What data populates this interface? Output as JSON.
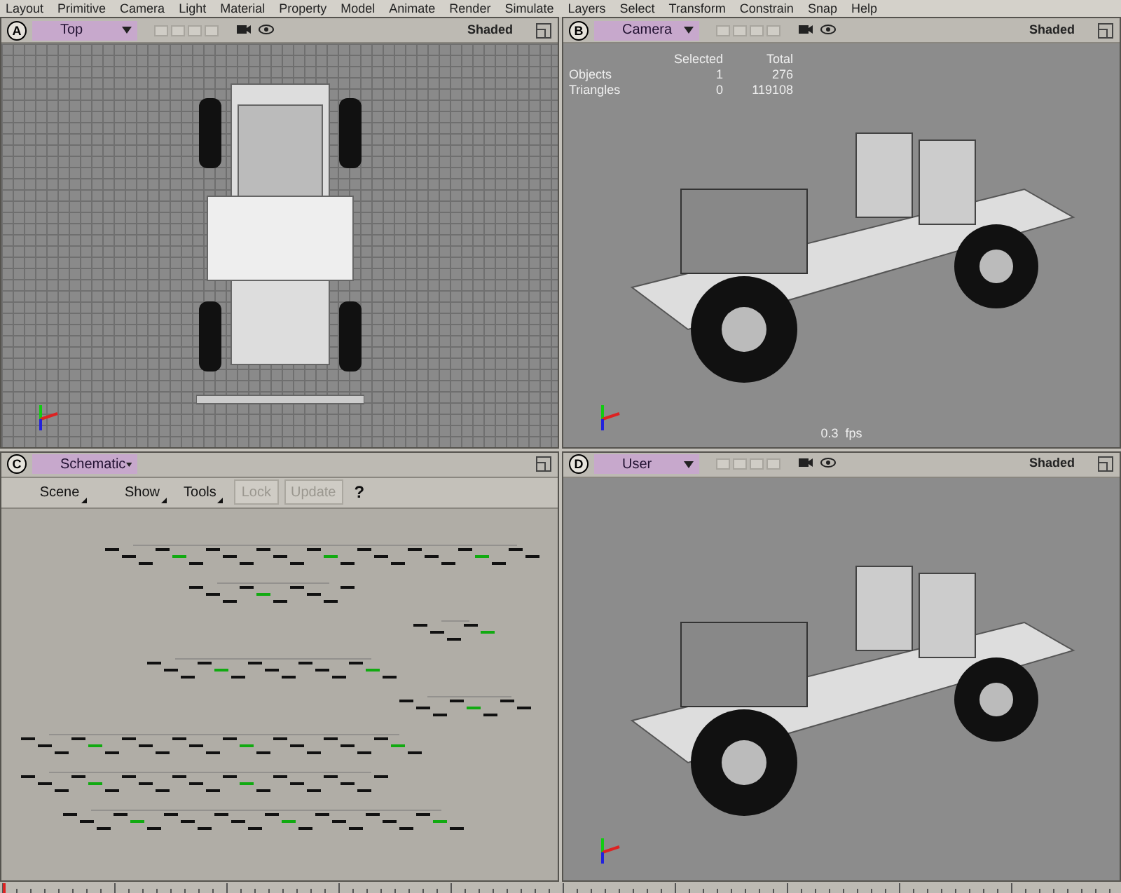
{
  "menu": [
    "Layout",
    "Primitive",
    "Camera",
    "Light",
    "Material",
    "Property",
    "Model",
    "Animate",
    "Render",
    "Simulate",
    "Layers",
    "Select",
    "Transform",
    "Constrain",
    "Snap",
    "Help"
  ],
  "viewports": [
    {
      "letter": "A",
      "title": "Top",
      "kind": "top",
      "mode": "Shaded"
    },
    {
      "letter": "B",
      "title": "Camera",
      "kind": "camera",
      "mode": "Shaded",
      "stats": {
        "headers": [
          "Selected",
          "Total"
        ],
        "rows": [
          {
            "label": "Objects",
            "selected": "1",
            "total": "276"
          },
          {
            "label": "Triangles",
            "selected": "0",
            "total": "119108"
          }
        ]
      },
      "fps": "0.3  fps"
    },
    {
      "letter": "C",
      "title": "Schematic",
      "kind": "schematic",
      "toolbar": [
        {
          "label": "Scene",
          "disabled": false,
          "menu": true
        },
        {
          "label": "Show",
          "disabled": false,
          "menu": true
        },
        {
          "label": "Tools",
          "disabled": false,
          "menu": true
        },
        {
          "label": "Lock",
          "disabled": true,
          "menu": false
        },
        {
          "label": "Update",
          "disabled": true,
          "menu": false
        },
        {
          "label": "?",
          "disabled": false,
          "menu": false
        }
      ]
    },
    {
      "letter": "D",
      "title": "User",
      "kind": "user",
      "mode": "Shaded"
    }
  ]
}
